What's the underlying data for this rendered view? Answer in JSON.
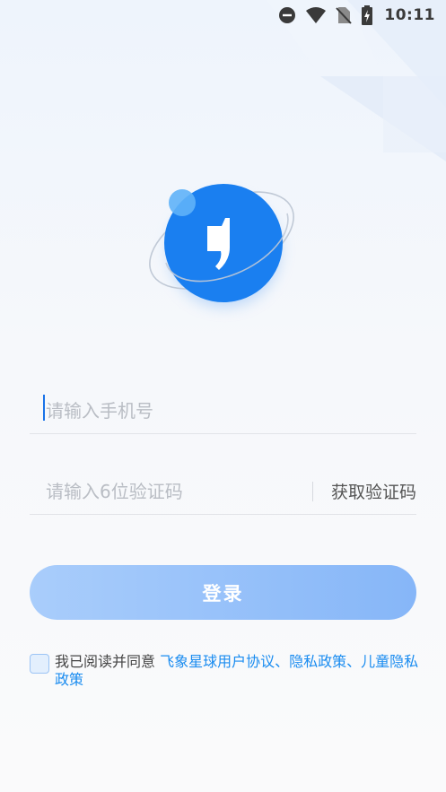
{
  "status_bar": {
    "time": "10:11",
    "icons": [
      "do-not-disturb-icon",
      "wifi-icon",
      "no-sim-icon",
      "battery-charging-icon"
    ]
  },
  "colors": {
    "brand": "#1a7ff0",
    "link": "#1a8cf0",
    "button_start": "#a9cdfb",
    "button_end": "#86b6f8"
  },
  "login": {
    "phone_placeholder": "请输入手机号",
    "code_placeholder": "请输入6位验证码",
    "get_code_label": "获取验证码",
    "submit_label": "登录"
  },
  "agreement": {
    "prefix": "我已阅读并同意 ",
    "user_agreement": "飞象星球用户协议",
    "sep1": "、",
    "privacy_policy": "隐私政策",
    "sep2": "、",
    "child_privacy": "儿童隐私政策",
    "checked": false
  }
}
